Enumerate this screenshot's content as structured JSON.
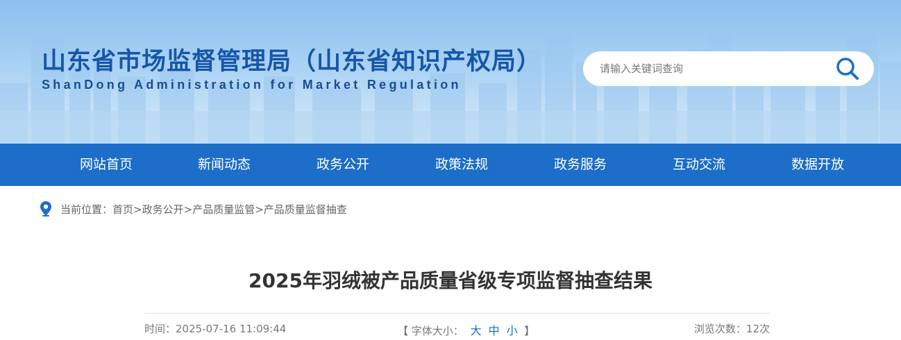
{
  "header": {
    "title": "山东省市场监督管理局（山东省知识产权局）",
    "subtitle": "ShanDong Administration for Market Regulation",
    "search": {
      "placeholder": "请输入关键词查询",
      "icon": "search-icon"
    }
  },
  "nav": {
    "items": [
      {
        "label": "网站首页"
      },
      {
        "label": "新闻动态"
      },
      {
        "label": "政务公开"
      },
      {
        "label": "政策法规"
      },
      {
        "label": "政务服务"
      },
      {
        "label": "互动交流"
      },
      {
        "label": "数据开放"
      }
    ]
  },
  "breadcrumb": {
    "icon": "location-pin-icon",
    "prefix": "当前位置：",
    "items": [
      "首页",
      "政务公开",
      "产品质量监管",
      "产品质量监督抽查"
    ],
    "separator": ">"
  },
  "article": {
    "title": "2025年羽绒被产品质量省级专项监督抽查结果",
    "time_label": "时间：",
    "time": "2025-07-16 11:09:44",
    "font_label": "字体大小：",
    "font_open": "【",
    "font_close": "】",
    "font_sizes": [
      "大",
      "中",
      "小"
    ],
    "views_label": "浏览次数：",
    "views": "12次"
  },
  "colors": {
    "brand_blue": "#1c6ec8",
    "title_blue": "#1656a8",
    "text_gray": "#666666"
  }
}
